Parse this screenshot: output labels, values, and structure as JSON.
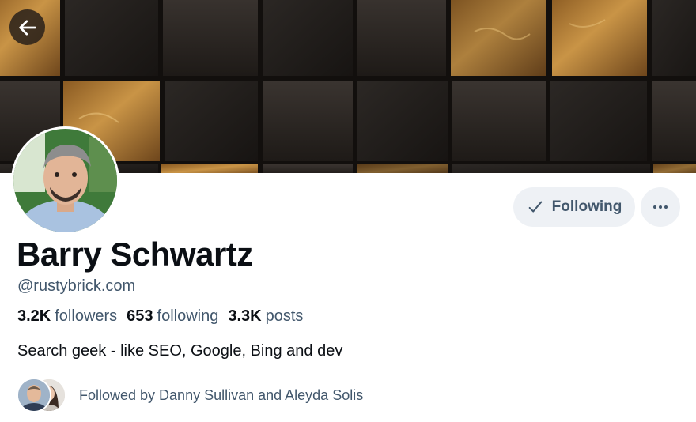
{
  "profile": {
    "display_name": "Barry Schwartz",
    "handle": "@rustybrick.com",
    "bio": "Search geek - like SEO, Google, Bing and dev"
  },
  "stats": [
    {
      "value": "3.2K",
      "label": "followers"
    },
    {
      "value": "653",
      "label": "following"
    },
    {
      "value": "3.3K",
      "label": "posts"
    }
  ],
  "actions": {
    "following_label": "Following",
    "more_icon": "ellipsis-icon",
    "back_icon": "arrow-left-icon",
    "check_icon": "checkmark-icon"
  },
  "followed_by": {
    "text": "Followed by Danny Sullivan and Aleyda Solis"
  },
  "colors": {
    "text_primary": "#0b0f14",
    "text_secondary": "#42576c",
    "button_bg": "#eef1f5",
    "banner_gold": "#b8843a",
    "banner_dark": "#1f1b18"
  }
}
